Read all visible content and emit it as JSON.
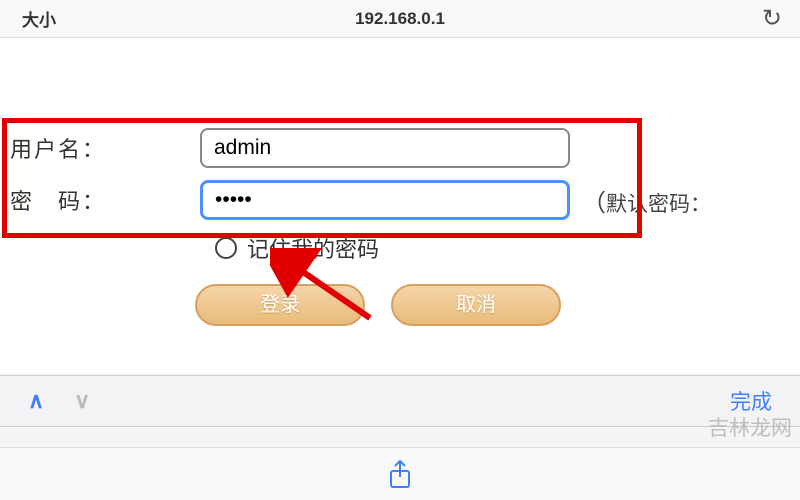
{
  "browser": {
    "size_label": "大小",
    "url": "192.168.0.1"
  },
  "form": {
    "username_label": "用户名：",
    "username_value": "admin",
    "password_label": "密　码：",
    "password_value": "•••••",
    "hint_open": "（",
    "hint_text": "默认密码：",
    "remember_label": "记住我的密码",
    "login_btn": "登录",
    "cancel_btn": "取消"
  },
  "accessory": {
    "done": "完成"
  },
  "watermark": "吉林龙网"
}
